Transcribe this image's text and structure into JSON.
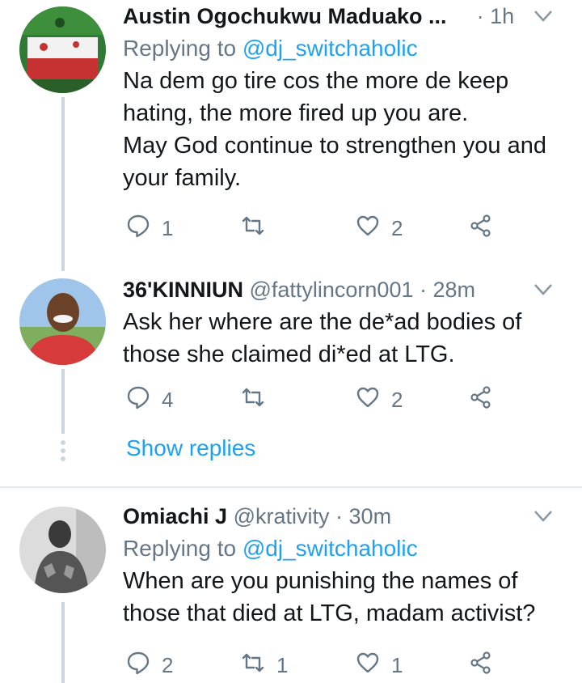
{
  "tweets": [
    {
      "name": "Austin Ogochukwu Maduako ...",
      "handle": "",
      "dot": "·",
      "time": "1h",
      "replying_prefix": "Replying to ",
      "replying_mention": "@dj_switchaholic",
      "body_lines": [
        "Na dem go tire cos the more de keep",
        "hating, the more fired up you are.",
        "May God continue to strengthen you and",
        "your family."
      ],
      "reply_count": "1",
      "retweet_count": "",
      "like_count": "2"
    },
    {
      "name": "36'KINNIUN",
      "handle": "@fattylincorn001",
      "dot": "·",
      "time": "28m",
      "replying_prefix": "",
      "replying_mention": "",
      "body_lines": [
        "Ask her where are the de*ad bodies of",
        "those she claimed di*ed at LTG."
      ],
      "reply_count": "4",
      "retweet_count": "",
      "like_count": "2"
    },
    {
      "name": "Omiachi J",
      "handle": "@krativity",
      "dot": "·",
      "time": "30m",
      "replying_prefix": "Replying to ",
      "replying_mention": "@dj_switchaholic",
      "body_lines": [
        "When are you punishing the names of",
        "those that died at LTG, madam activist?"
      ],
      "reply_count": "2",
      "retweet_count": "1",
      "like_count": "1"
    }
  ],
  "show_replies_label": "Show replies",
  "icons": [
    "reply-icon",
    "retweet-icon",
    "like-icon",
    "share-icon",
    "chevron-down-icon"
  ],
  "colors": {
    "link": "#1da1f2",
    "muted": "#657786",
    "line": "#ccd6dd",
    "text": "#14171a"
  }
}
